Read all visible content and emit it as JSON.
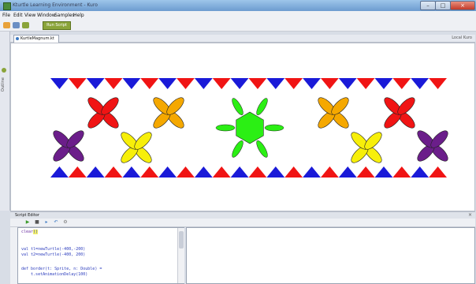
{
  "window": {
    "title": "Kturtle Learning Environment - Kuro",
    "buttons": {
      "minimize": "–",
      "maximize": "□",
      "close": "×"
    }
  },
  "menu": [
    "File",
    "Edit",
    "View",
    "Window",
    "Samples",
    "Help"
  ],
  "toolbar": {
    "run_label": "Run Script"
  },
  "sidebar": {
    "label": "Outline"
  },
  "tabs": {
    "active": "KurtleMagnum.kt",
    "right_label": "Local Kuro"
  },
  "bottom_panel": {
    "tab_label": "Script Editor",
    "close": "×"
  },
  "editor": {
    "lines": [
      {
        "pre": "clear",
        "hl": "()",
        "post": ""
      },
      {
        "pre": "",
        "hl": "",
        "post": ""
      },
      {
        "pre": "val tl=newTurtle(-400,-200)",
        "hl": "",
        "post": ""
      },
      {
        "pre": "val t2=newTurtle(-400, 200)",
        "hl": "",
        "post": ""
      },
      {
        "pre": "",
        "hl": "",
        "post": ""
      },
      {
        "pre": "def border(t: Sprite, n: Double) =",
        "hl": "",
        "post": ""
      },
      {
        "pre": "    t.setAnimationDelay(100)",
        "hl": "",
        "post": ""
      }
    ]
  },
  "scene": {
    "colors": {
      "blue": "#1a1ad8",
      "red": "#f01414",
      "yellow": "#f7ef0a",
      "orange": "#f5a800",
      "purple": "#6b1e8a",
      "green": "#2bef14"
    },
    "border_triangles": 22,
    "flowers": [
      "purple",
      "red",
      "yellow",
      "orange",
      "green",
      "orange",
      "yellow",
      "red",
      "purple"
    ]
  }
}
